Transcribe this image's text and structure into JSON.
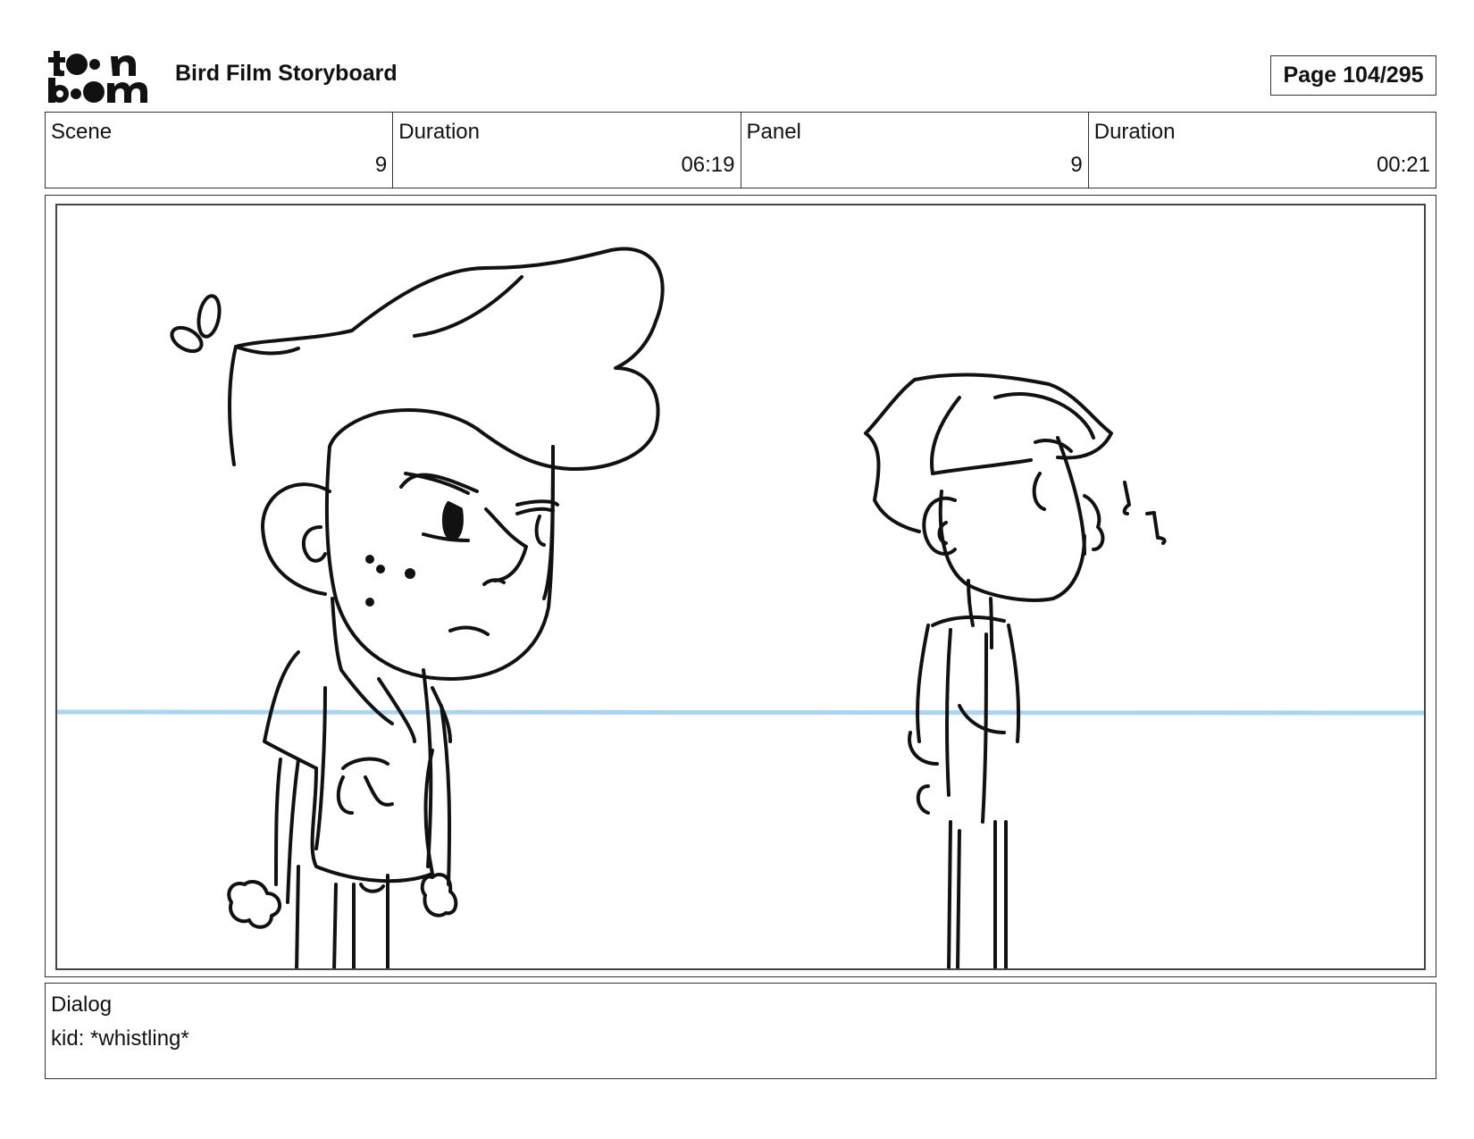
{
  "header": {
    "logo_text": "toon boom",
    "title": "Bird Film Storyboard",
    "page": "Page 104/295"
  },
  "meta": {
    "scene_label": "Scene",
    "scene_value": "9",
    "scene_duration_label": "Duration",
    "scene_duration_value": "06:19",
    "panel_label": "Panel",
    "panel_value": "9",
    "panel_duration_label": "Duration",
    "panel_duration_value": "00:21"
  },
  "dialog": {
    "label": "Dialog",
    "text": "kid: *whistling*"
  },
  "colors": {
    "guide_line": "#a9d4f2",
    "ink": "#111111"
  }
}
